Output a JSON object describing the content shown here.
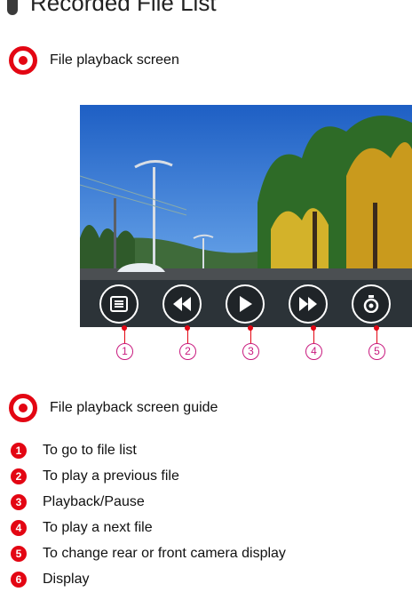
{
  "header": {
    "title": "Recorded File List"
  },
  "sections": {
    "playback": {
      "heading": "File playback screen"
    },
    "guide": {
      "heading": "File playback screen guide"
    }
  },
  "controls": [
    {
      "number": "1",
      "icon": "list-icon"
    },
    {
      "number": "2",
      "icon": "rewind-icon"
    },
    {
      "number": "3",
      "icon": "play-icon"
    },
    {
      "number": "4",
      "icon": "fast-forward-icon"
    },
    {
      "number": "5",
      "icon": "camera-switch-icon"
    }
  ],
  "guide_items": [
    {
      "number": "1",
      "text": "To go to file list"
    },
    {
      "number": "2",
      "text": "To play a previous file"
    },
    {
      "number": "3",
      "text": "Playback/Pause"
    },
    {
      "number": "4",
      "text": "To play a next file"
    },
    {
      "number": "5",
      "text": "To change rear or front camera display"
    },
    {
      "number": "6",
      "text": "Display"
    }
  ],
  "colors": {
    "accent_red": "#e30613",
    "badge_magenta": "#c8197e",
    "control_bar": "#2c3338",
    "sky": "#2d6fd0"
  }
}
